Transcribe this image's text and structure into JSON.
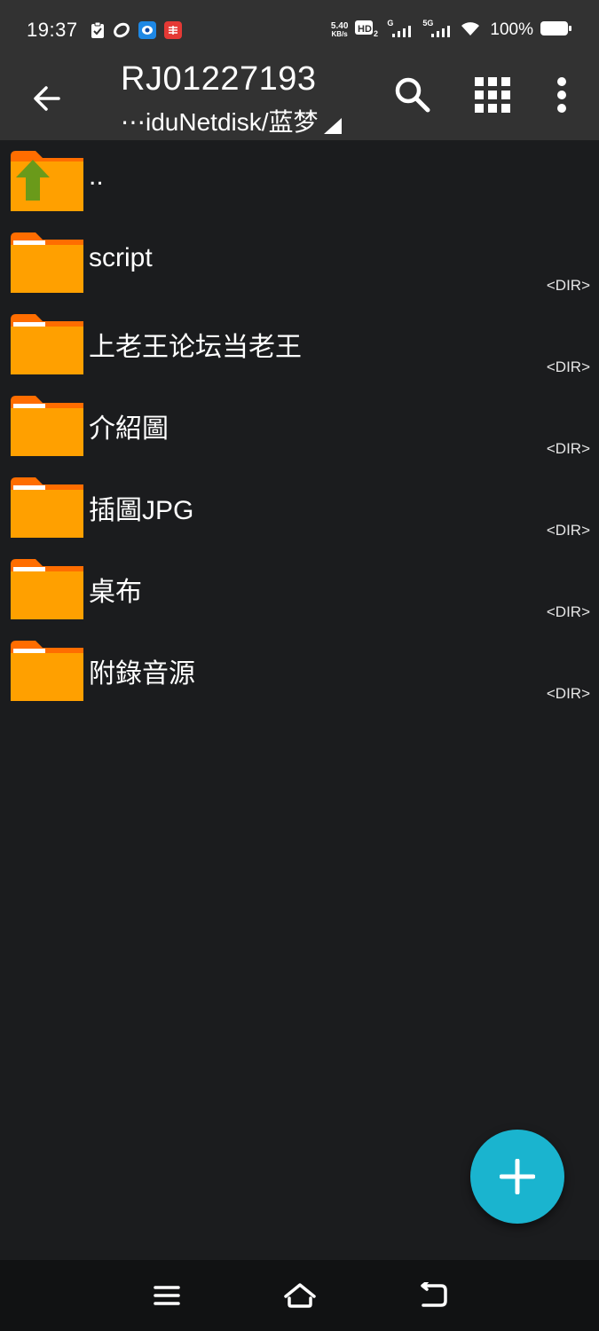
{
  "status_bar": {
    "time": "19:37",
    "net_speed_value": "5.40",
    "net_speed_unit": "KB/s",
    "signal_1_label": "G",
    "signal_2_label": "5G",
    "battery_percent": "100%",
    "notification_icons": [
      "clipboard-check-icon",
      "swirl-app-icon",
      "messenger-app-icon",
      "red-app-icon"
    ]
  },
  "app_bar": {
    "title": "RJ01227193",
    "path": "⋯iduNetdisk/蓝梦"
  },
  "files": [
    {
      "name": "..",
      "meta": "",
      "type": "parent"
    },
    {
      "name": "script",
      "meta": "<DIR>",
      "type": "folder"
    },
    {
      "name": "上老王论坛当老王",
      "meta": "<DIR>",
      "type": "folder"
    },
    {
      "name": "介紹圖",
      "meta": "<DIR>",
      "type": "folder"
    },
    {
      "name": "插圖JPG",
      "meta": "<DIR>",
      "type": "folder"
    },
    {
      "name": "桌布",
      "meta": "<DIR>",
      "type": "folder"
    },
    {
      "name": "附錄音源",
      "meta": "<DIR>",
      "type": "folder"
    }
  ],
  "colors": {
    "folder_orange": "#ffa000",
    "folder_tab": "#ff6d00",
    "up_arrow_green": "#6a9a1a",
    "fab": "#1ab4cf",
    "app_bar": "#323232",
    "background": "#1b1c1e"
  }
}
